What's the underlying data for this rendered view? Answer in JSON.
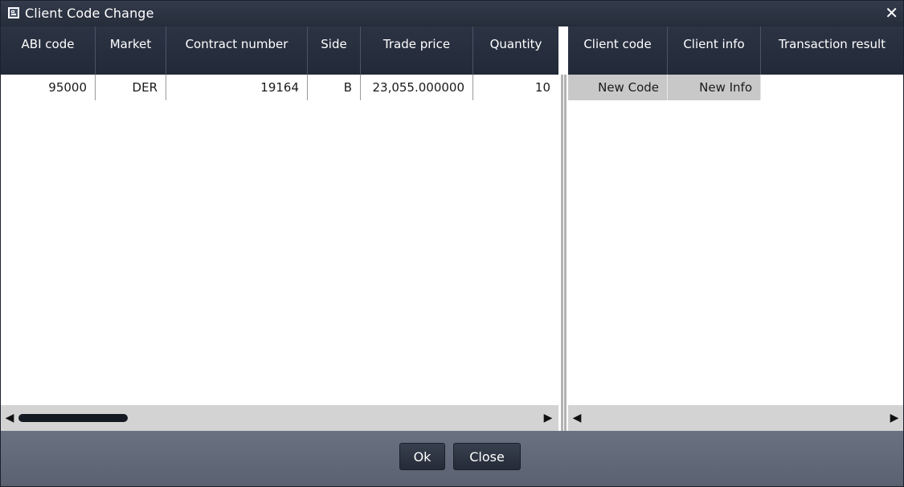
{
  "window": {
    "title": "Client Code Change",
    "close_glyph": "✕"
  },
  "left_table": {
    "columns": [
      "ABI code",
      "Market",
      "Contract number",
      "Side",
      "Trade price",
      "Quantity"
    ],
    "rows": [
      [
        "95000",
        "DER",
        "19164",
        "B",
        "23,055.000000",
        "10"
      ]
    ]
  },
  "right_table": {
    "columns": [
      "Client code",
      "Client info",
      "Transaction result"
    ],
    "rows": [
      [
        "New Code",
        "New Info",
        ""
      ]
    ]
  },
  "scrollbars": {
    "left_arrow": "◀",
    "right_arrow": "▶"
  },
  "buttons": {
    "ok": "Ok",
    "close": "Close"
  },
  "colors": {
    "header_bg": "#262d3a",
    "footer_bg": "#5f6777",
    "editable_cell_bg": "#c8c8c8"
  }
}
